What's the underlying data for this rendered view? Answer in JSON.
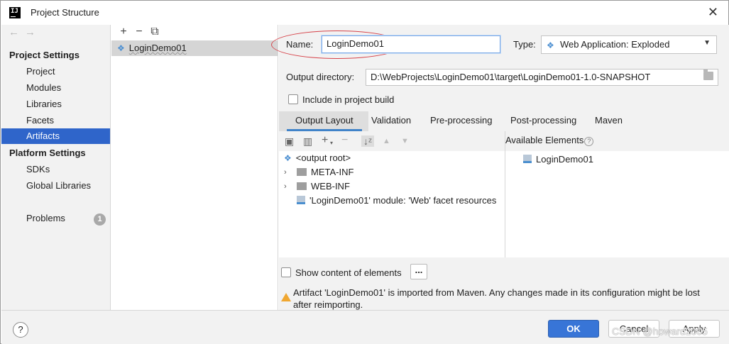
{
  "window": {
    "title": "Project Structure"
  },
  "nav": {
    "sections": [
      {
        "title": "Project Settings",
        "items": [
          "Project",
          "Modules",
          "Libraries",
          "Facets",
          "Artifacts"
        ]
      },
      {
        "title": "Platform Settings",
        "items": [
          "SDKs",
          "Global Libraries"
        ]
      }
    ],
    "selected": "Artifacts",
    "problems": {
      "label": "Problems",
      "count": "1"
    }
  },
  "artifacts": {
    "toolbar": [
      "+",
      "−",
      "⧉"
    ],
    "items": [
      "LoginDemo01"
    ]
  },
  "detail": {
    "name_label": "Name:",
    "name_value": "LoginDemo01",
    "type_label": "Type:",
    "type_value": "Web Application: Exploded",
    "output_dir_label": "Output directory:",
    "output_dir_value": "D:\\WebProjects\\LoginDemo01\\target\\LoginDemo01-1.0-SNAPSHOT",
    "include_in_build_label": "Include in project build",
    "tabs": [
      "Output Layout",
      "Validation",
      "Pre-processing",
      "Post-processing",
      "Maven"
    ],
    "active_tab": "Output Layout",
    "tree": [
      "<output root>",
      "META-INF",
      "WEB-INF",
      "'LoginDemo01' module: 'Web' facet resources"
    ],
    "available_label": "Available Elements",
    "available_items": [
      "LoginDemo01"
    ],
    "show_content_label": "Show content of elements",
    "dots_label": "...",
    "warning": "Artifact 'LoginDemo01' is imported from Maven. Any changes made in its configuration might be lost after reimporting."
  },
  "footer": {
    "help": "?",
    "ok": "OK",
    "cancel": "Cancel",
    "apply": "Apply",
    "watermark": "CSDN @howard2005"
  },
  "colors": {
    "accent": "#2f65ca",
    "ok_button": "#3875d7",
    "highlight_ellipse": "#d6434a",
    "warning": "#f0a731"
  }
}
